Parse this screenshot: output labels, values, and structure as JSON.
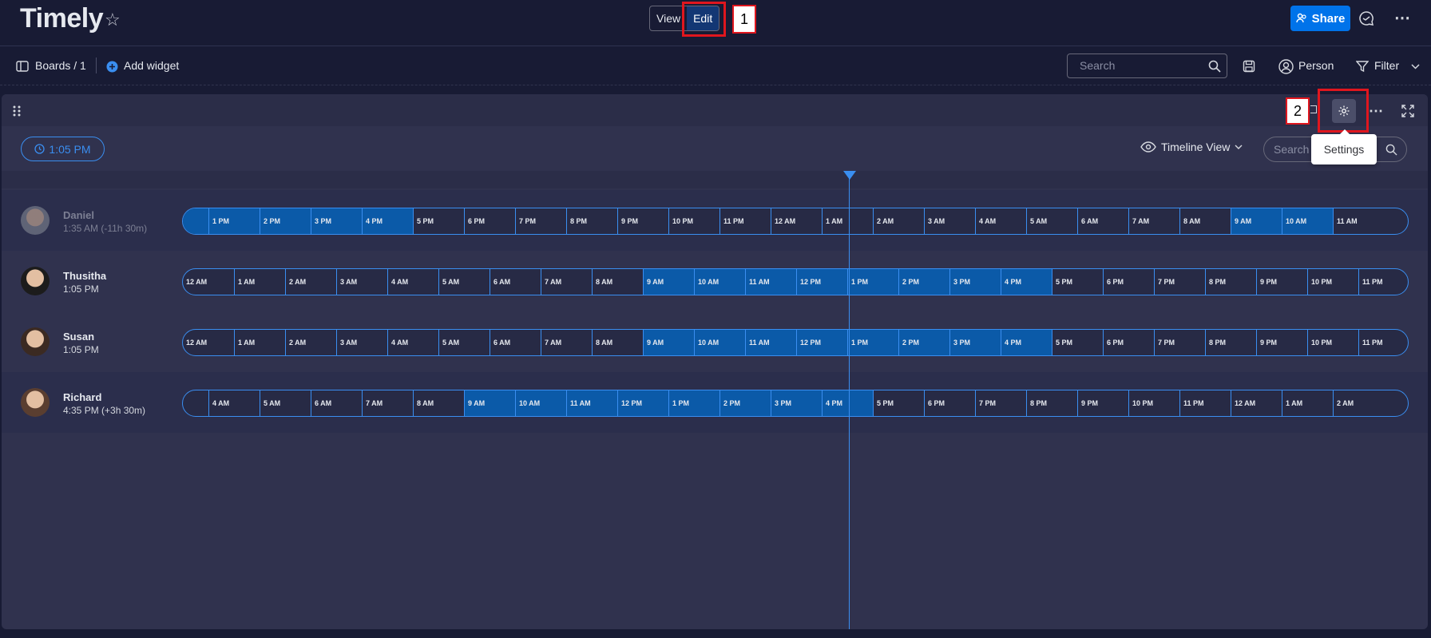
{
  "app": {
    "title": "Timely"
  },
  "mode": {
    "view_label": "View",
    "edit_label": "Edit"
  },
  "header": {
    "share_label": "Share"
  },
  "toolbar": {
    "boards": "Boards / 1",
    "add_widget": "Add widget",
    "search_placeholder": "Search",
    "person": "Person",
    "filter": "Filter"
  },
  "widget": {
    "current_time": "1:05 PM",
    "view_mode": "Timeline View",
    "search_placeholder": "Search",
    "tooltip": "Settings"
  },
  "annotations": [
    "1",
    "2"
  ],
  "colors": {
    "accent": "#0073ea",
    "timeline": "#3a8ef0",
    "work_hours": "#0b5aa8",
    "annotation": "#e0161e"
  },
  "people": [
    {
      "name": "Daniel",
      "time": "1:35 AM",
      "offset": "(-11h 30m)",
      "dimmed": true,
      "hours": [
        "1 PM",
        "2 PM",
        "3 PM",
        "4 PM",
        "5 PM",
        "6 PM",
        "7 PM",
        "8 PM",
        "9 PM",
        "10 PM",
        "11 PM",
        "12 AM",
        "1 AM",
        "2 AM",
        "3 AM",
        "4 AM",
        "5 AM",
        "6 AM",
        "7 AM",
        "8 AM",
        "9 AM",
        "10 AM",
        "11 AM"
      ],
      "start_offset": 0.5,
      "work": [
        [
          0,
          4
        ],
        [
          20,
          22
        ]
      ]
    },
    {
      "name": "Thusitha",
      "time": "1:05 PM",
      "offset": "",
      "dimmed": false,
      "hours": [
        "12 AM",
        "1 AM",
        "2 AM",
        "3 AM",
        "4 AM",
        "5 AM",
        "6 AM",
        "7 AM",
        "8 AM",
        "9 AM",
        "10 AM",
        "11 AM",
        "12 PM",
        "1 PM",
        "2 PM",
        "3 PM",
        "4 PM",
        "5 PM",
        "6 PM",
        "7 PM",
        "8 PM",
        "9 PM",
        "10 PM",
        "11 PM"
      ],
      "start_offset": 0,
      "work": [
        [
          9,
          17
        ]
      ]
    },
    {
      "name": "Susan",
      "time": "1:05 PM",
      "offset": "",
      "dimmed": false,
      "hours": [
        "12 AM",
        "1 AM",
        "2 AM",
        "3 AM",
        "4 AM",
        "5 AM",
        "6 AM",
        "7 AM",
        "8 AM",
        "9 AM",
        "10 AM",
        "11 AM",
        "12 PM",
        "1 PM",
        "2 PM",
        "3 PM",
        "4 PM",
        "5 PM",
        "6 PM",
        "7 PM",
        "8 PM",
        "9 PM",
        "10 PM",
        "11 PM"
      ],
      "start_offset": 0,
      "work": [
        [
          9,
          17
        ]
      ]
    },
    {
      "name": "Richard",
      "time": "4:35 PM",
      "offset": "(+3h 30m)",
      "dimmed": false,
      "hours": [
        "4 AM",
        "5 AM",
        "6 AM",
        "7 AM",
        "8 AM",
        "9 AM",
        "10 AM",
        "11 AM",
        "12 PM",
        "1 PM",
        "2 PM",
        "3 PM",
        "4 PM",
        "5 PM",
        "6 PM",
        "7 PM",
        "8 PM",
        "9 PM",
        "10 PM",
        "11 PM",
        "12 AM",
        "1 AM",
        "2 AM"
      ],
      "start_offset": 0.5,
      "work": [
        [
          5,
          13
        ]
      ]
    }
  ]
}
